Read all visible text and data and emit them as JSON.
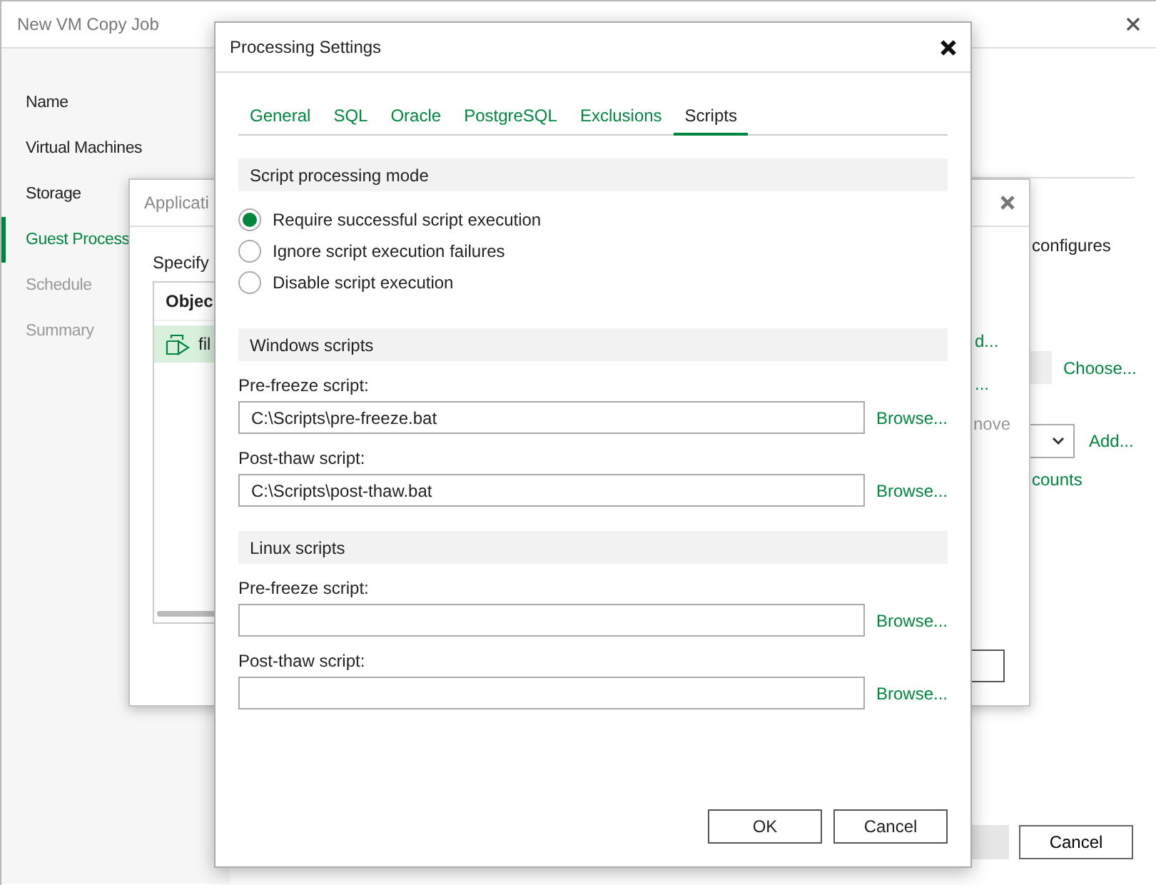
{
  "wizard": {
    "title": "New VM Copy Job",
    "steps": [
      {
        "label": "Name",
        "selected": false,
        "disabled": false
      },
      {
        "label": "Virtual Machines",
        "selected": false,
        "disabled": false
      },
      {
        "label": "Storage",
        "selected": false,
        "disabled": false
      },
      {
        "label": "Guest Process",
        "selected": true,
        "disabled": false
      },
      {
        "label": "Schedule",
        "selected": false,
        "disabled": true
      },
      {
        "label": "Summary",
        "selected": false,
        "disabled": true
      }
    ],
    "description": "configures",
    "choose_link": "Choose...",
    "add_link": "Add...",
    "accounts_link": "counts",
    "cancel_button": "Cancel"
  },
  "application_dialog": {
    "title": "Applicati",
    "instruction": "Specify",
    "table": {
      "columns": [
        "Objec"
      ],
      "rows": [
        {
          "cells": [
            "fil"
          ],
          "selected": true
        }
      ]
    },
    "links": [
      {
        "label": "d...",
        "disabled": false
      },
      {
        "label": "...",
        "disabled": false
      },
      {
        "label": "nove",
        "disabled": true
      }
    ]
  },
  "processing_settings": {
    "title": "Processing Settings",
    "tabs": [
      {
        "label": "General",
        "selected": false
      },
      {
        "label": "SQL",
        "selected": false
      },
      {
        "label": "Oracle",
        "selected": false
      },
      {
        "label": "PostgreSQL",
        "selected": false
      },
      {
        "label": "Exclusions",
        "selected": false
      },
      {
        "label": "Scripts",
        "selected": true
      }
    ],
    "mode_section": {
      "title": "Script processing mode",
      "options": [
        {
          "label": "Require successful script execution",
          "selected": true
        },
        {
          "label": "Ignore script execution failures",
          "selected": false
        },
        {
          "label": "Disable script execution",
          "selected": false
        }
      ]
    },
    "script_sections": [
      {
        "title": "Windows scripts",
        "fields": [
          {
            "label": "Pre-freeze script:",
            "value": "C:\\Scripts\\pre-freeze.bat",
            "browse": "Browse..."
          },
          {
            "label": "Post-thaw script:",
            "value": "C:\\Scripts\\post-thaw.bat",
            "browse": "Browse..."
          }
        ]
      },
      {
        "title": "Linux scripts",
        "fields": [
          {
            "label": "Pre-freeze script:",
            "browse": "Browse..."
          },
          {
            "label": "Post-thaw script:",
            "browse": "Browse..."
          }
        ]
      }
    ],
    "buttons": [
      "OK",
      "Cancel"
    ]
  }
}
